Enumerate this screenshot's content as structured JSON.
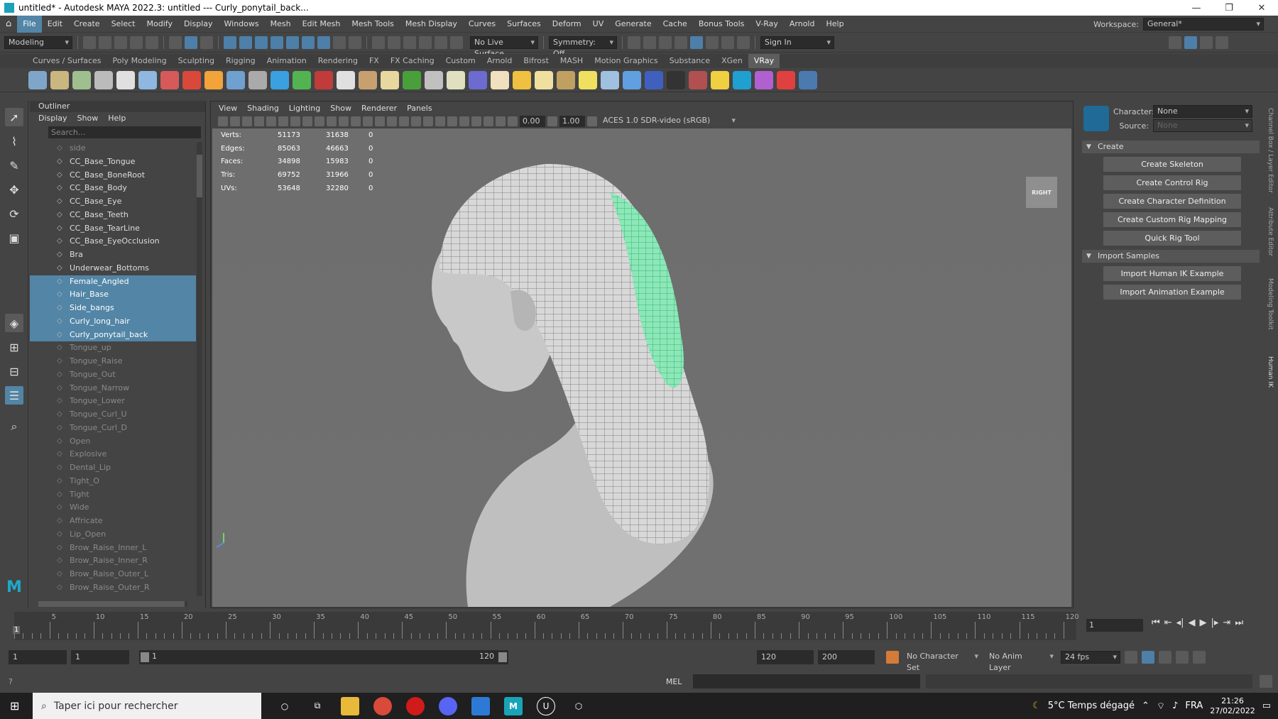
{
  "window": {
    "title": "untitled* - Autodesk MAYA 2022.3: untitled   ---   Curly_ponytail_back...",
    "controls": [
      "—",
      "❐",
      "✕"
    ]
  },
  "menubar": {
    "items": [
      "File",
      "Edit",
      "Create",
      "Select",
      "Modify",
      "Display",
      "Windows",
      "Mesh",
      "Edit Mesh",
      "Mesh Tools",
      "Mesh Display",
      "Curves",
      "Surfaces",
      "Deform",
      "UV",
      "Generate",
      "Cache",
      "Bonus Tools",
      "V-Ray",
      "Arnold",
      "Help"
    ],
    "workspace_label": "Workspace:",
    "workspace_value": "General*"
  },
  "statusline": {
    "mode": "Modeling",
    "live_surface": "No Live Surface",
    "symmetry": "Symmetry: Off",
    "sign_in": "Sign In"
  },
  "shelf": {
    "tabs": [
      "Curves / Surfaces",
      "Poly Modeling",
      "Sculpting",
      "Rigging",
      "Animation",
      "Rendering",
      "FX",
      "FX Caching",
      "Custom",
      "Arnold",
      "Bifrost",
      "MASH",
      "Motion Graphics",
      "Substance",
      "XGen",
      "VRay"
    ],
    "active_tab": "VRay",
    "icon_colors": [
      "#7fa6c9",
      "#c9b77f",
      "#9fbf8f",
      "#bbbbbb",
      "#e0e0e0",
      "#8fb7e0",
      "#d65a5a",
      "#d9483b",
      "#f2a33a",
      "#6fa0d0",
      "#aaaaaa",
      "#3aa0e0",
      "#53b353",
      "#c23b3b",
      "#e0e0e0",
      "#c8a070",
      "#e8d8a0",
      "#49a03b",
      "#c0c0c0",
      "#e0e0c0",
      "#6b6bd0",
      "#f0e0c0",
      "#f0c040",
      "#f0e0a0",
      "#c0a060",
      "#f0e060",
      "#a0c0e0",
      "#60a0e0",
      "#4060c0",
      "#333333",
      "#b05050",
      "#f0d040",
      "#1fa0d0",
      "#b060d0",
      "#e04040",
      "#4a7ab0"
    ]
  },
  "outliner": {
    "title": "Outliner",
    "menu": [
      "Display",
      "Show",
      "Help"
    ],
    "search_placeholder": "Search...",
    "rows": [
      {
        "label": "side",
        "state": "dim"
      },
      {
        "label": "CC_Base_Tongue",
        "state": "normal"
      },
      {
        "label": "CC_Base_BoneRoot",
        "state": "normal"
      },
      {
        "label": "CC_Base_Body",
        "state": "normal"
      },
      {
        "label": "CC_Base_Eye",
        "state": "normal"
      },
      {
        "label": "CC_Base_Teeth",
        "state": "normal"
      },
      {
        "label": "CC_Base_TearLine",
        "state": "normal"
      },
      {
        "label": "CC_Base_EyeOcclusion",
        "state": "normal"
      },
      {
        "label": "Bra",
        "state": "normal"
      },
      {
        "label": "Underwear_Bottoms",
        "state": "normal"
      },
      {
        "label": "Female_Angled",
        "state": "selected"
      },
      {
        "label": "Hair_Base",
        "state": "selected"
      },
      {
        "label": "Side_bangs",
        "state": "selected"
      },
      {
        "label": "Curly_long_hair",
        "state": "selected"
      },
      {
        "label": "Curly_ponytail_back",
        "state": "selected"
      },
      {
        "label": "Tongue_up",
        "state": "dim"
      },
      {
        "label": "Tongue_Raise",
        "state": "dim"
      },
      {
        "label": "Tongue_Out",
        "state": "dim"
      },
      {
        "label": "Tongue_Narrow",
        "state": "dim"
      },
      {
        "label": "Tongue_Lower",
        "state": "dim"
      },
      {
        "label": "Tongue_Curl_U",
        "state": "dim"
      },
      {
        "label": "Tongue_Curl_D",
        "state": "dim"
      },
      {
        "label": "Open",
        "state": "dim"
      },
      {
        "label": "Explosive",
        "state": "dim"
      },
      {
        "label": "Dental_Lip",
        "state": "dim"
      },
      {
        "label": "Tight_O",
        "state": "dim"
      },
      {
        "label": "Tight",
        "state": "dim"
      },
      {
        "label": "Wide",
        "state": "dim"
      },
      {
        "label": "Affricate",
        "state": "dim"
      },
      {
        "label": "Lip_Open",
        "state": "dim"
      },
      {
        "label": "Brow_Raise_Inner_L",
        "state": "dim"
      },
      {
        "label": "Brow_Raise_Inner_R",
        "state": "dim"
      },
      {
        "label": "Brow_Raise_Outer_L",
        "state": "dim"
      },
      {
        "label": "Brow_Raise_Outer_R",
        "state": "dim"
      }
    ]
  },
  "viewport": {
    "menu": [
      "View",
      "Shading",
      "Lighting",
      "Show",
      "Renderer",
      "Panels"
    ],
    "exposure": "0.00",
    "gamma": "1.00",
    "color_space": "ACES 1.0 SDR-video (sRGB)",
    "viewcube": "RIGHT",
    "hud": [
      {
        "label": "Verts:",
        "a": "51173",
        "b": "31638",
        "c": "0"
      },
      {
        "label": "Edges:",
        "a": "85063",
        "b": "46663",
        "c": "0"
      },
      {
        "label": "Faces:",
        "a": "34898",
        "b": "15983",
        "c": "0"
      },
      {
        "label": "Tris:",
        "a": "69752",
        "b": "31966",
        "c": "0"
      },
      {
        "label": "UVs:",
        "a": "53648",
        "b": "32280",
        "c": "0"
      }
    ]
  },
  "hik": {
    "character_label": "Character:",
    "character_value": "None",
    "source_label": "Source:",
    "source_value": "None",
    "create_section": "Create",
    "create_buttons": [
      "Create Skeleton",
      "Create Control Rig",
      "Create Character Definition",
      "Create Custom Rig Mapping",
      "Quick Rig Tool"
    ],
    "import_section": "Import Samples",
    "import_buttons": [
      "Import Human IK Example",
      "Import Animation Example"
    ]
  },
  "side_tabs": [
    "Channel Box / Layer Editor",
    "Attribute Editor",
    "Modeling Toolkit",
    "Human IK"
  ],
  "timeline": {
    "labels": [
      "5",
      "10",
      "15",
      "20",
      "25",
      "30",
      "35",
      "40",
      "45",
      "50",
      "55",
      "60",
      "65",
      "70",
      "75",
      "80",
      "85",
      "90",
      "95",
      "100",
      "105",
      "110",
      "115",
      "120"
    ],
    "current_frame": "1",
    "playhead_label": "1"
  },
  "range": {
    "start": "1",
    "start2": "1",
    "slider_start": "1",
    "slider_end": "120",
    "end": "120",
    "end2": "200",
    "character_set": "No Character Set",
    "anim_layer": "No Anim Layer",
    "fps": "24 fps"
  },
  "cmdline": {
    "lang": "MEL"
  },
  "taskbar": {
    "search": "Taper ici pour rechercher",
    "weather": "5°C  Temps dégagé",
    "lang": "FRA",
    "time": "21:26",
    "date": "27/02/2022"
  }
}
